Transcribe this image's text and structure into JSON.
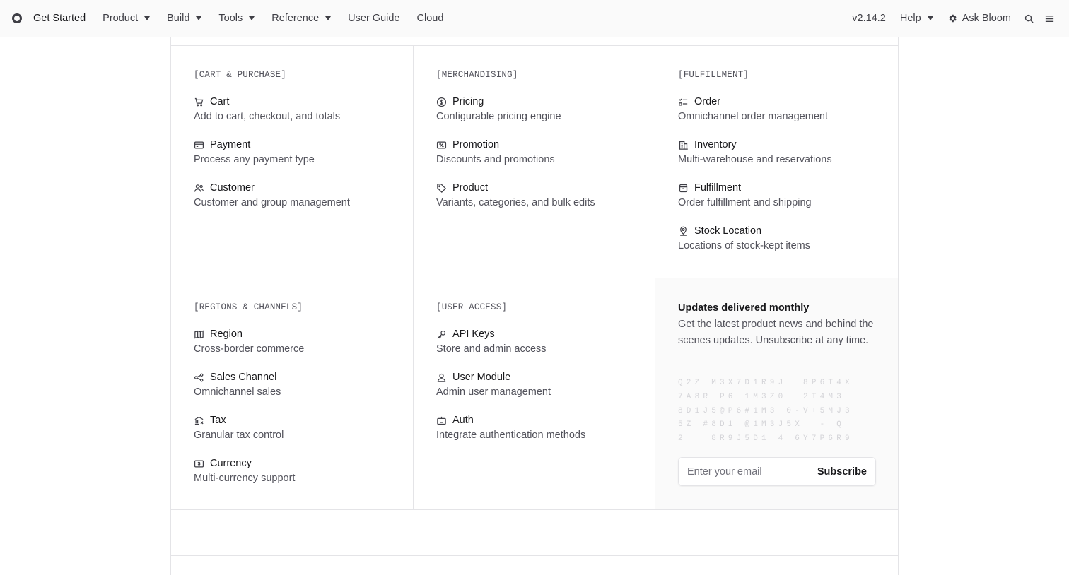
{
  "nav": {
    "items": [
      {
        "label": "Get Started",
        "dropdown": false
      },
      {
        "label": "Product",
        "dropdown": true
      },
      {
        "label": "Build",
        "dropdown": true
      },
      {
        "label": "Tools",
        "dropdown": true
      },
      {
        "label": "Reference",
        "dropdown": true
      },
      {
        "label": "User Guide",
        "dropdown": false
      },
      {
        "label": "Cloud",
        "dropdown": false
      }
    ],
    "version": "v2.14.2",
    "help": "Help",
    "ask": "Ask Bloom",
    "icons": [
      "search-icon",
      "menu-icon"
    ]
  },
  "sections": [
    {
      "label": "[CART & PURCHASE]",
      "items": [
        {
          "icon": "cart-icon",
          "title": "Cart",
          "desc": "Add to cart, checkout, and totals"
        },
        {
          "icon": "credit-card-icon",
          "title": "Payment",
          "desc": "Process any payment type"
        },
        {
          "icon": "users-icon",
          "title": "Customer",
          "desc": "Customer and group management"
        }
      ]
    },
    {
      "label": "[MERCHANDISING]",
      "items": [
        {
          "icon": "currency-dollar-icon",
          "title": "Pricing",
          "desc": "Configurable pricing engine"
        },
        {
          "icon": "receipt-percent-icon",
          "title": "Promotion",
          "desc": "Discounts and promotions"
        },
        {
          "icon": "tag-icon",
          "title": "Product",
          "desc": "Variants, categories, and bulk edits"
        }
      ]
    },
    {
      "label": "[FULFILLMENT]",
      "items": [
        {
          "icon": "checklist-icon",
          "title": "Order",
          "desc": "Omnichannel order management"
        },
        {
          "icon": "building-icon",
          "title": "Inventory",
          "desc": "Multi-warehouse and reservations"
        },
        {
          "icon": "box-icon",
          "title": "Fulfillment",
          "desc": "Order fulfillment and shipping"
        },
        {
          "icon": "map-pin-icon",
          "title": "Stock Location",
          "desc": "Locations of stock-kept items"
        }
      ]
    },
    {
      "label": "[REGIONS & CHANNELS]",
      "items": [
        {
          "icon": "map-icon",
          "title": "Region",
          "desc": "Cross-border commerce"
        },
        {
          "icon": "share-icon",
          "title": "Sales Channel",
          "desc": "Omnichannel sales"
        },
        {
          "icon": "tax-icon",
          "title": "Tax",
          "desc": "Granular tax control"
        },
        {
          "icon": "banknote-icon",
          "title": "Currency",
          "desc": "Multi-currency support"
        }
      ]
    },
    {
      "label": "[USER ACCESS]",
      "items": [
        {
          "icon": "key-icon",
          "title": "API Keys",
          "desc": "Store and admin access"
        },
        {
          "icon": "user-icon",
          "title": "User Module",
          "desc": "Admin user management"
        },
        {
          "icon": "robot-icon",
          "title": "Auth",
          "desc": "Integrate authentication methods"
        }
      ]
    }
  ],
  "newsletter": {
    "title": "Updates delivered monthly",
    "desc": "Get the latest product news and behind the scenes updates. Unsubscribe at any time.",
    "noise_lines": [
      "Q2Z M3X7D1R9J  8P6T4X",
      "7A8R P6 1M3Z0  2T4M3",
      "8D1J5@P6#1M3 0-V+5MJ3",
      "5Z #8D1 @1M3J5X  - Q",
      "2   8R9J5D1 4 6Y7P6R9"
    ],
    "email_placeholder": "Enter your email",
    "subscribe_label": "Subscribe"
  }
}
